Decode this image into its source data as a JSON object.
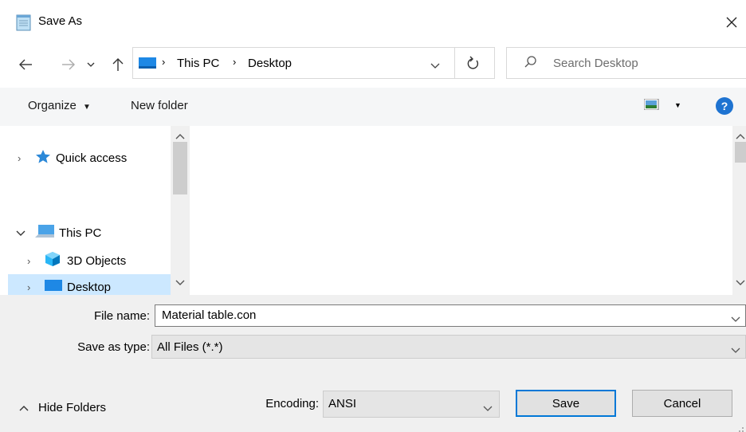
{
  "window": {
    "title": "Save As"
  },
  "nav": {
    "breadcrumb": [
      "This PC",
      "Desktop"
    ],
    "search_placeholder": "Search Desktop"
  },
  "toolbar": {
    "organize": "Organize",
    "new_folder": "New folder"
  },
  "tree": {
    "quick_access": "Quick access",
    "this_pc": "This PC",
    "objects_3d": "3D Objects",
    "desktop": "Desktop"
  },
  "form": {
    "file_name_label": "File name:",
    "file_name_value": "Material table.con",
    "save_type_label": "Save as type:",
    "save_type_value": "All Files  (*.*)",
    "encoding_label": "Encoding:",
    "encoding_value": "ANSI"
  },
  "buttons": {
    "save": "Save",
    "cancel": "Cancel",
    "hide_folders": "Hide Folders"
  },
  "colors": {
    "accent": "#0078d7",
    "selected": "#cce8ff",
    "help": "#1e73d1"
  }
}
